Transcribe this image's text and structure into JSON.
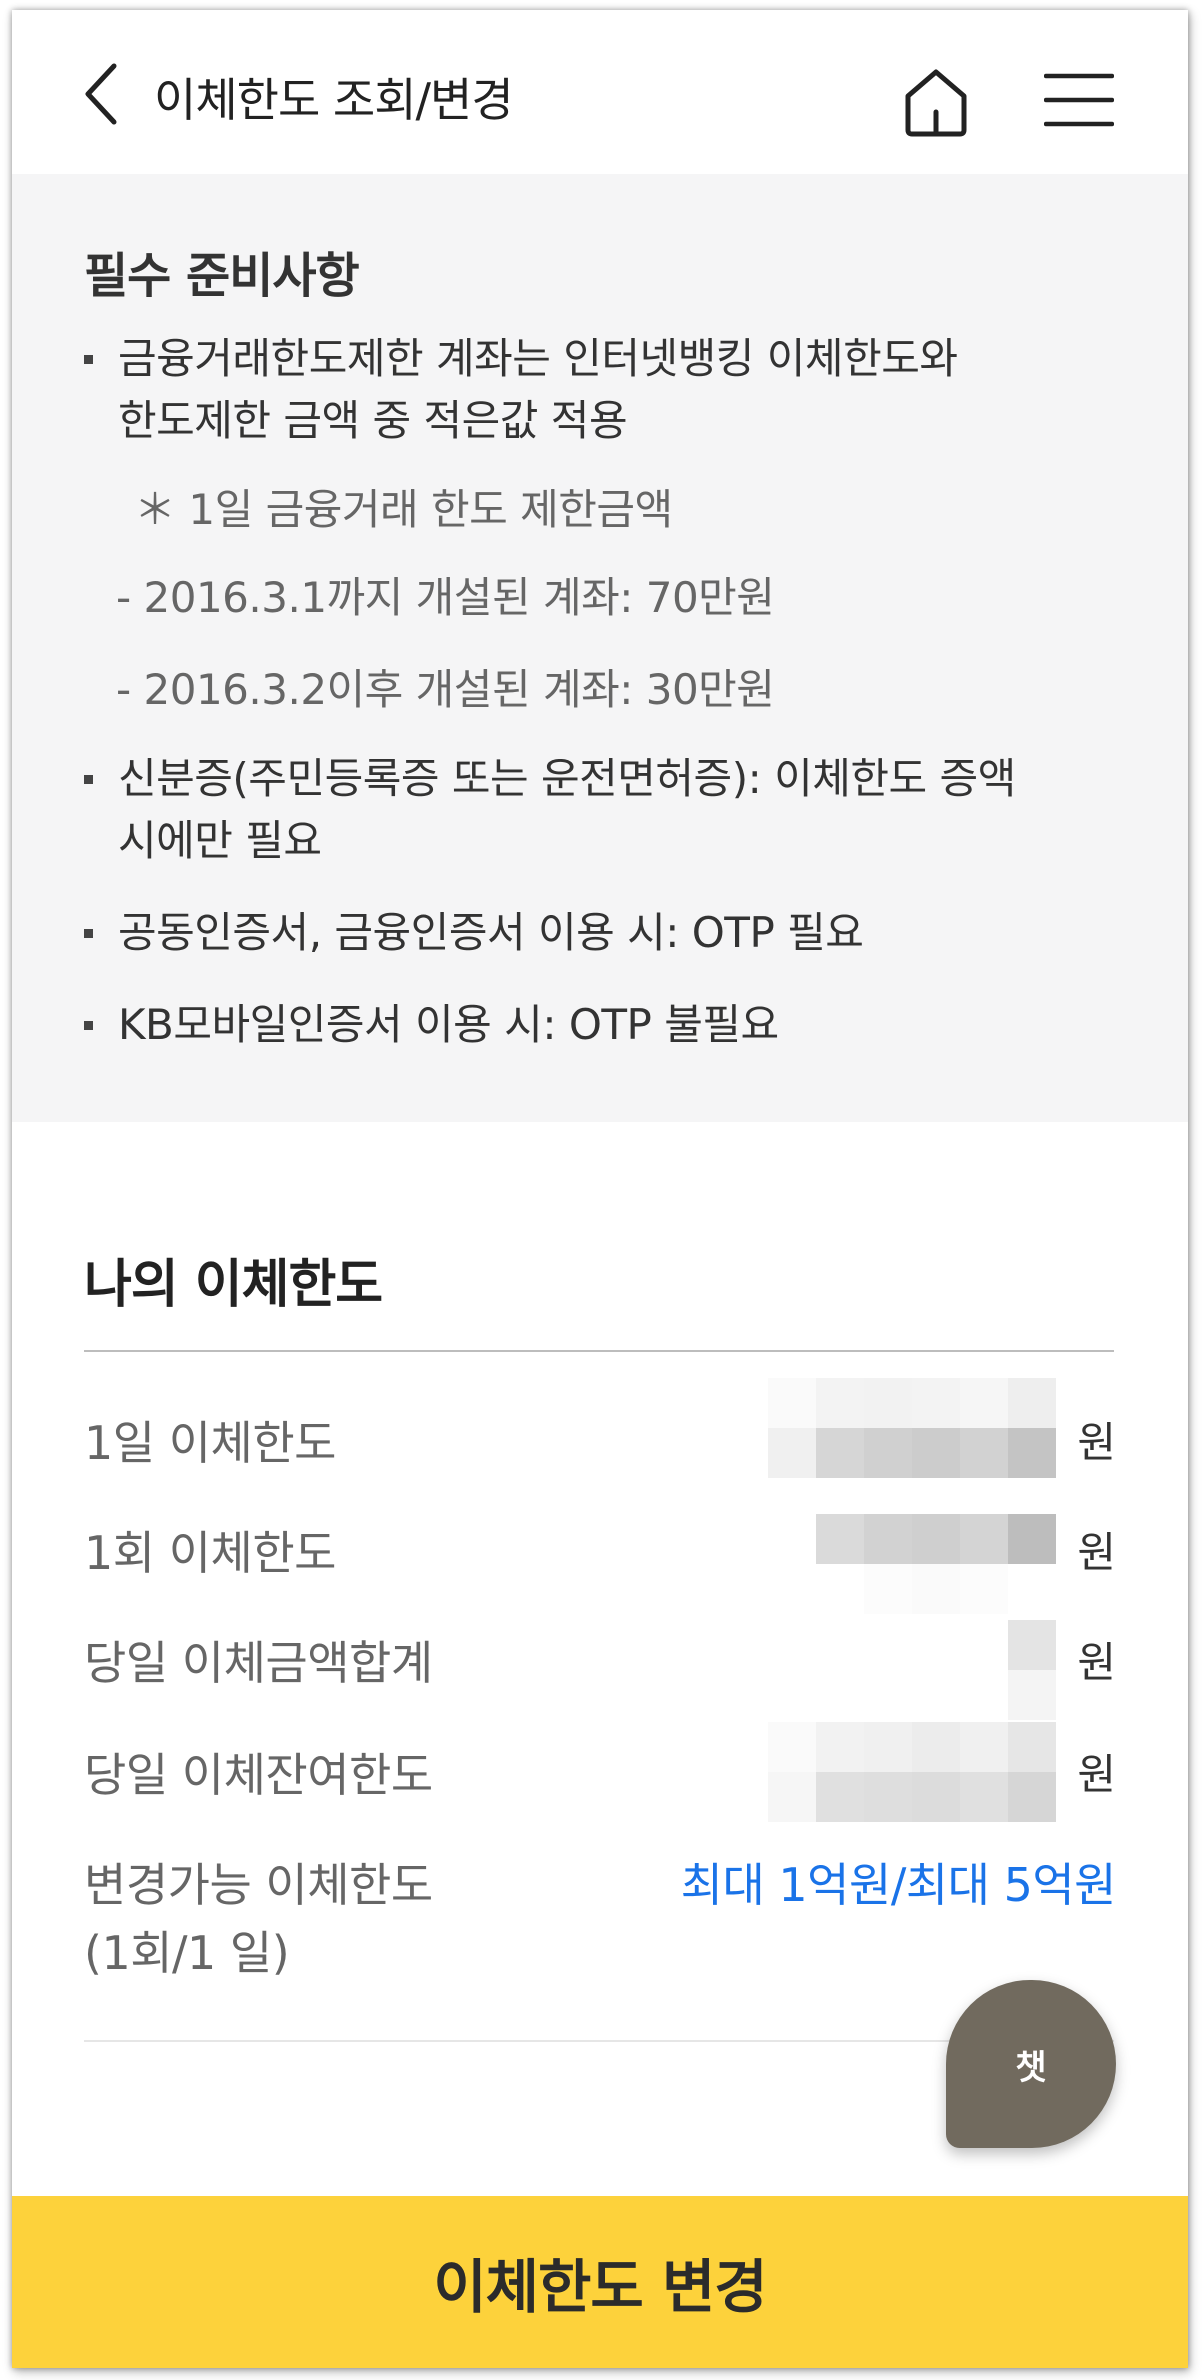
{
  "header": {
    "title": "이체한도 조회/변경",
    "back_icon": "chevron-left-icon",
    "home_icon": "home-icon",
    "menu_icon": "hamburger-menu-icon"
  },
  "notice": {
    "title": "필수 준비사항",
    "items": [
      "금융거래한도제한 계좌는 인터넷뱅킹 이체한도와\n한도제한 금액 중 적은값 적용",
      "신분증(주민등록증 또는 운전면허증): 이체한도 증액\n시에만 필요",
      "공동인증서, 금융인증서 이용 시: OTP 필요",
      "KB모바일인증서 이용 시: OTP 불필요"
    ],
    "sub_note": "＊ 1일 금융거래 한도 제한금액",
    "sub_items": [
      "- 2016.3.1까지 개설된 계좌: 70만원",
      "- 2016.3.2이후 개설된 계좌: 30만원"
    ]
  },
  "my_limit": {
    "title": "나의 이체한도",
    "rows": [
      {
        "label": "1일 이체한도",
        "unit": "원"
      },
      {
        "label": "1회 이체한도",
        "unit": "원"
      },
      {
        "label": "당일 이체금액합계",
        "unit": "원"
      },
      {
        "label": "당일 이체잔여한도",
        "unit": "원"
      }
    ],
    "changeable": {
      "label_line1": "변경가능 이체한도",
      "label_line2": "(1회/1 일)",
      "value": "최대 1억원/최대 5억원"
    }
  },
  "chat_button": {
    "label": "챗"
  },
  "cta": {
    "label": "이체한도 변경"
  },
  "colors": {
    "cta_yellow": "#fdd23b",
    "link_blue": "#1a73e8",
    "chat_brown": "#716a5e",
    "notice_bg": "#f5f5f6"
  }
}
